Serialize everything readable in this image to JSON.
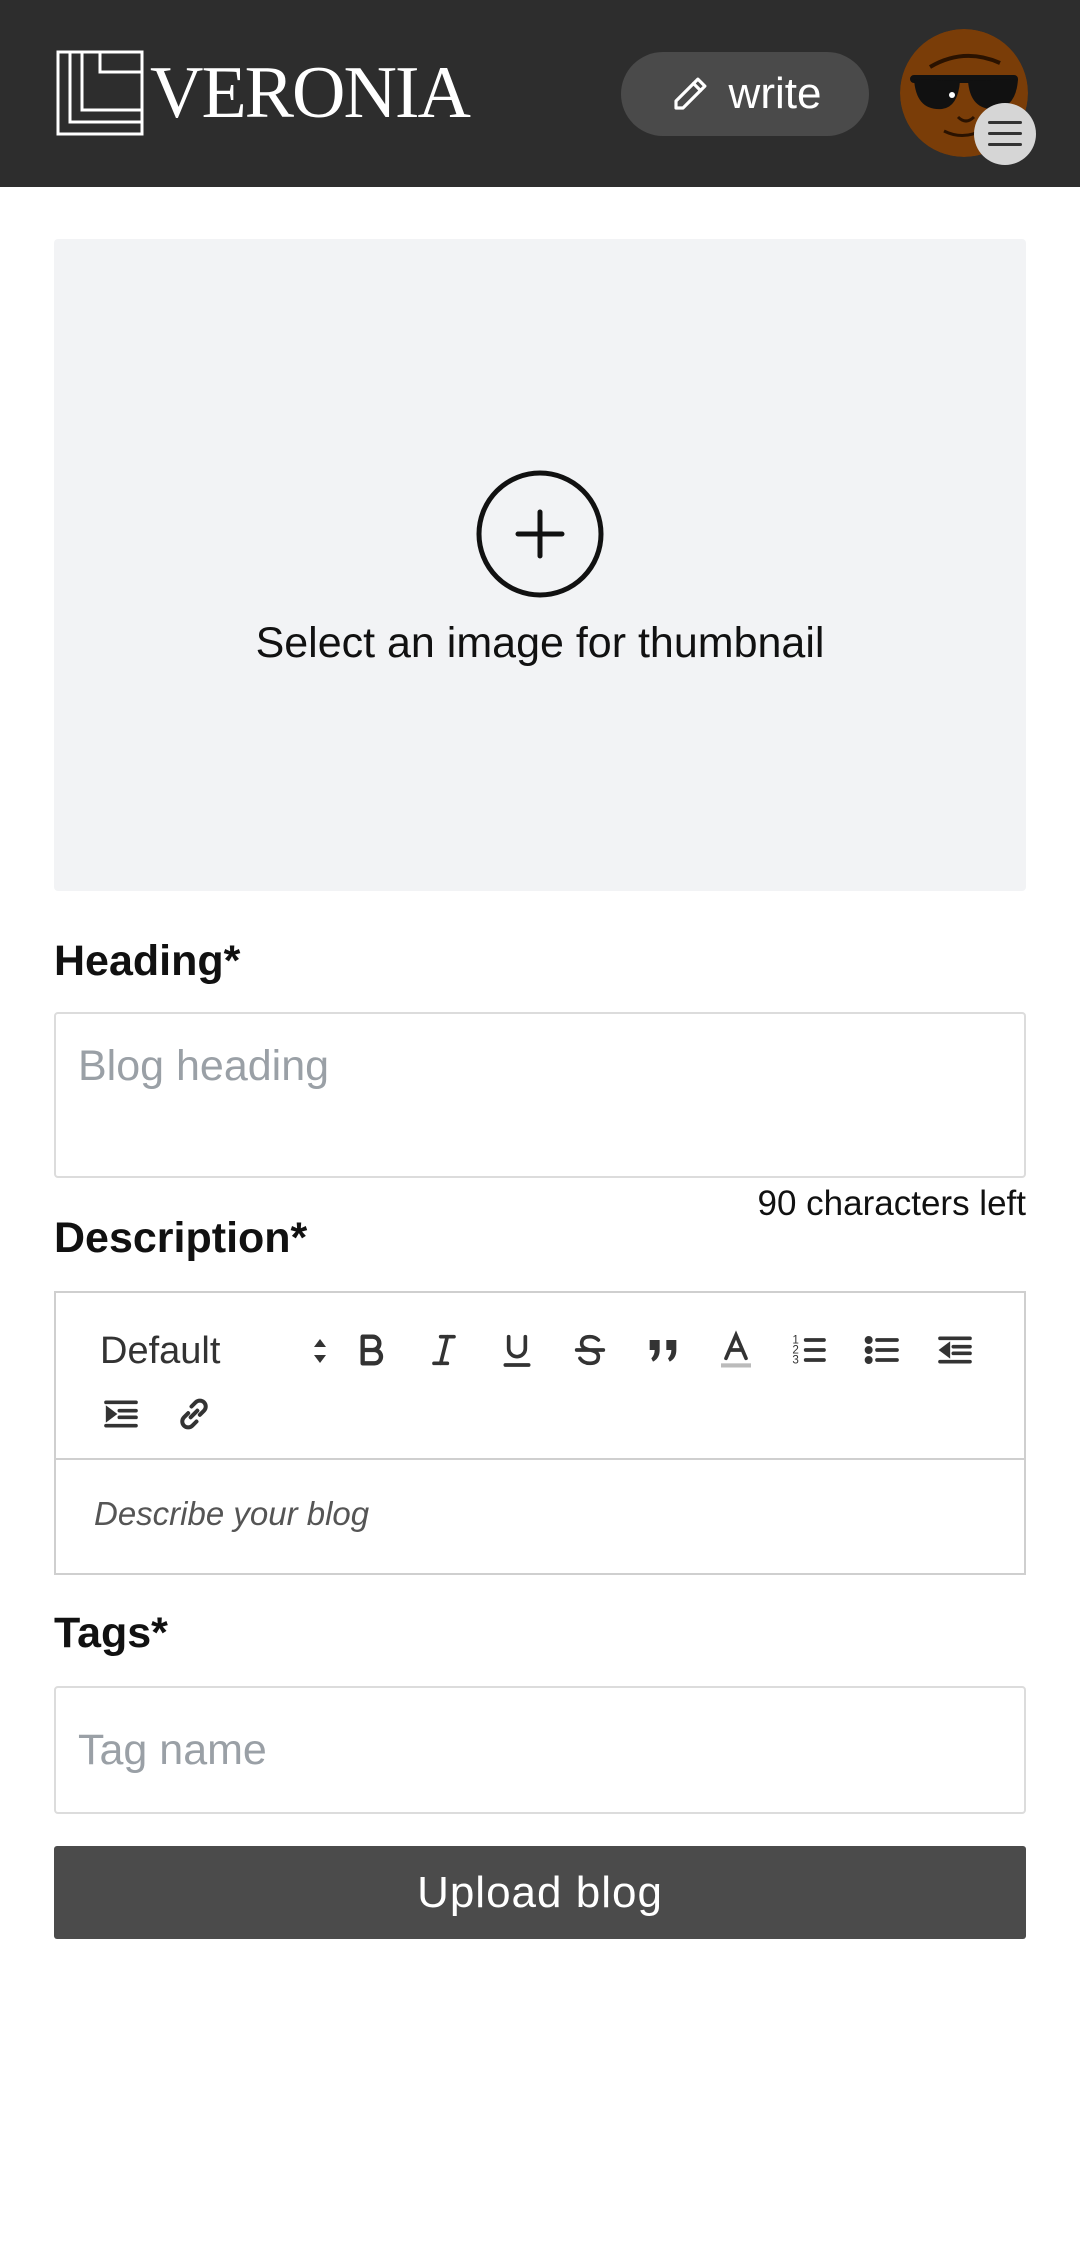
{
  "header": {
    "logo_text": "VERONIA",
    "write_label": "write",
    "icons": {
      "write": "pencil-icon",
      "menu": "hamburger-icon"
    }
  },
  "thumbnail": {
    "label": "Select an image for thumbnail",
    "icon": "plus-circle-icon"
  },
  "heading": {
    "label": "Heading*",
    "placeholder": "Blog heading",
    "counter": "90 characters left"
  },
  "description": {
    "label": "Description*",
    "toolbar": {
      "format_select": "Default",
      "buttons": [
        "bold-icon",
        "italic-icon",
        "underline-icon",
        "strikethrough-icon",
        "quote-icon",
        "text-color-icon",
        "ordered-list-icon",
        "bullet-list-icon",
        "outdent-icon",
        "indent-icon",
        "link-icon"
      ]
    },
    "placeholder": "Describe your blog"
  },
  "tags": {
    "label": "Tags*",
    "placeholder": "Tag name"
  },
  "submit_label": "Upload blog",
  "colors": {
    "topbar": "#2d2d2d",
    "write_button": "#4a4a4a",
    "upload_area": "#f2f3f5",
    "submit_button": "#4b4b4b",
    "avatar": "#7a3d08"
  }
}
